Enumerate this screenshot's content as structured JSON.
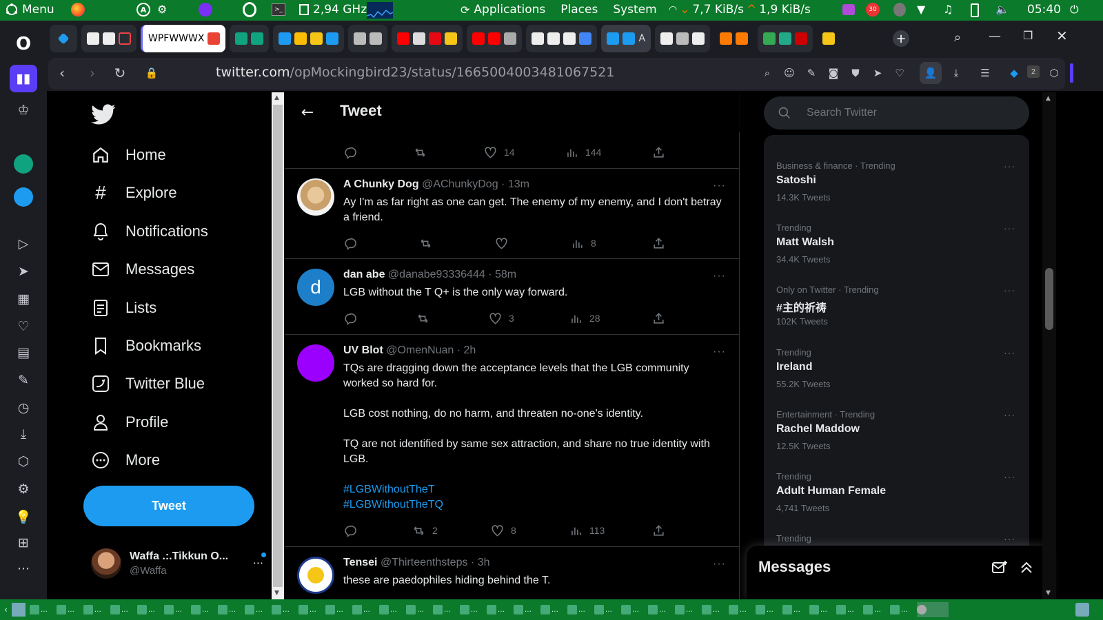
{
  "system_panel": {
    "menu_label": "Menu",
    "cpu_freq": "2,94 GHz",
    "apps_menu": [
      "Applications",
      "Places",
      "System"
    ],
    "net_down": "7,7 KiB/s",
    "net_up": "1,9 KiB/s",
    "clock": "05:40",
    "notification_count": "30"
  },
  "browser": {
    "url_domain": "twitter.com",
    "url_path": "/opMockingbird23/status/1665004003481067521",
    "tab_group_text": "WPFWWWX",
    "extensions_badge": "2"
  },
  "left_nav": {
    "items": [
      {
        "label": "Home",
        "icon": "home-icon"
      },
      {
        "label": "Explore",
        "icon": "hashtag-icon"
      },
      {
        "label": "Notifications",
        "icon": "bell-icon"
      },
      {
        "label": "Messages",
        "icon": "envelope-icon"
      },
      {
        "label": "Lists",
        "icon": "list-icon"
      },
      {
        "label": "Bookmarks",
        "icon": "bookmark-icon"
      },
      {
        "label": "Twitter Blue",
        "icon": "twitter-blue-icon"
      },
      {
        "label": "Profile",
        "icon": "person-icon"
      },
      {
        "label": "More",
        "icon": "more-circle-icon"
      }
    ],
    "tweet_button": "Tweet",
    "account": {
      "display_name": "Waffa .:.Tikkun O...",
      "handle": "@Waffa",
      "more": "···"
    }
  },
  "main": {
    "title": "Tweet",
    "top_actions": {
      "likes": "14",
      "views": "144"
    },
    "tweets": [
      {
        "name": "A Chunky Dog",
        "handle": "@AChunkyDog",
        "time": "13m",
        "avatar": "dog-photo",
        "body": "Ay I'm as far right as one can get. The enemy of my enemy, and I don't betray a friend.",
        "hashtags": [],
        "replies": "",
        "retweets": "",
        "likes": "",
        "views": "8"
      },
      {
        "name": "dan abe",
        "handle": "@danabe93336444",
        "time": "58m",
        "avatar_letter": "d",
        "body": "LGB without the T Q+ is the only way forward.",
        "hashtags": [],
        "replies": "",
        "retweets": "",
        "likes": "3",
        "views": "28"
      },
      {
        "name": "UV Blot",
        "handle": "@OmenNuan",
        "time": "2h",
        "body": "TQs are dragging down the acceptance levels that the LGB community worked so hard for.\n\nLGB cost nothing, do no harm, and threaten no-one's identity.\n\nTQ are not identified by same sex attraction, and share no true identity with LGB.",
        "hashtags": [
          "#LGBWithoutTheT",
          "#LGBWithoutTheTQ"
        ],
        "replies": "",
        "retweets": "2",
        "likes": "8",
        "views": "113"
      },
      {
        "name": "Tensei",
        "handle": "@Thirteenthsteps",
        "time": "3h",
        "avatar": "we-can-do-it-badge",
        "body": "these are paedophiles hiding behind the T."
      }
    ]
  },
  "right": {
    "search_placeholder": "Search Twitter",
    "trends": [
      {
        "context": "Business & finance · Trending",
        "topic": "Satoshi",
        "count": "14.3K Tweets"
      },
      {
        "context": "Trending",
        "topic": "Matt Walsh",
        "count": "34.4K Tweets"
      },
      {
        "context": "Only on Twitter · Trending",
        "topic": "#主的祈祷",
        "count": "102K Tweets"
      },
      {
        "context": "Trending",
        "topic": "Ireland",
        "count": "55.2K Tweets"
      },
      {
        "context": "Entertainment · Trending",
        "topic": "Rachel Maddow",
        "count": "12.5K Tweets"
      },
      {
        "context": "Trending",
        "topic": "Adult Human Female",
        "count": "4,741 Tweets"
      },
      {
        "context": "Trending",
        "topic": "",
        "count": ""
      }
    ],
    "messages_drawer": "Messages"
  },
  "colors": {
    "accent": "#1d9bf0",
    "background": "#000000",
    "panel": "#0b7a2a",
    "text_secondary": "#71767b",
    "uv_blot_avatar": "#9b00ff"
  }
}
